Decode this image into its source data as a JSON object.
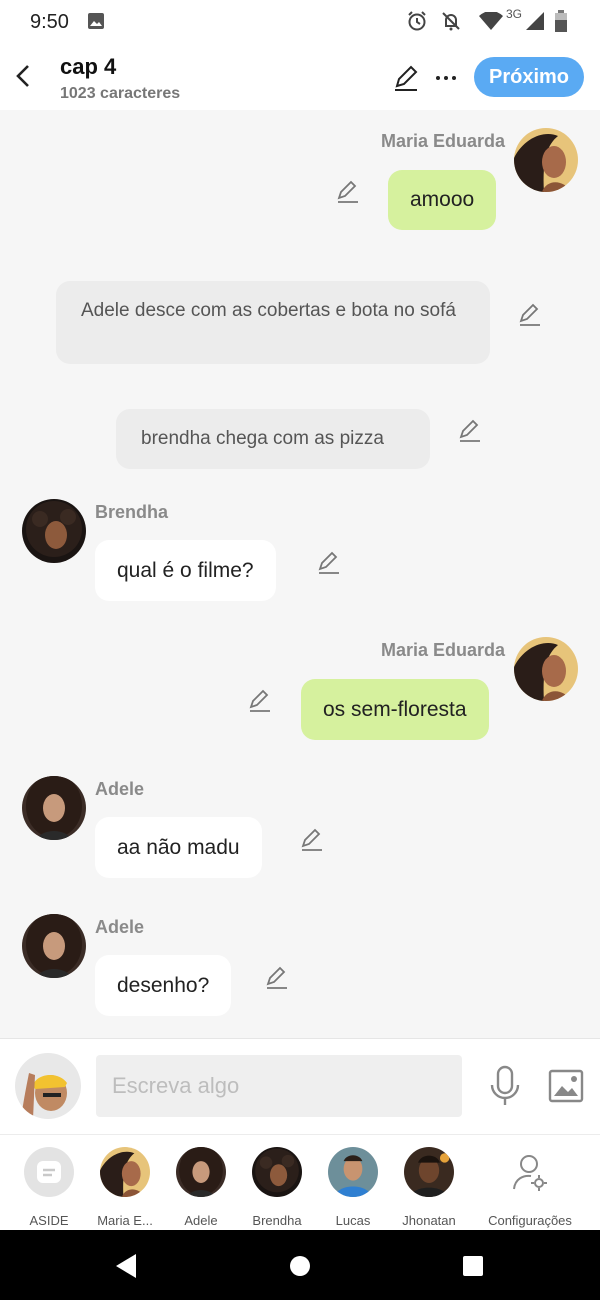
{
  "status_bar": {
    "time": "9:50",
    "network": "3G",
    "icons": [
      "image-icon",
      "alarm-icon",
      "notifications-off-icon",
      "wifi-icon",
      "cell-signal-icon",
      "battery-icon"
    ]
  },
  "header": {
    "title": "cap 4",
    "subtitle": "1023 caracteres",
    "next_label": "Próximo",
    "accent_color": "#5aaaf3"
  },
  "messages": [
    {
      "type": "message",
      "side": "right",
      "sender": "Maria Eduarda",
      "text": "amooo"
    },
    {
      "type": "narration",
      "text": "Adele desce com as cobertas e bota no sofá"
    },
    {
      "type": "narration",
      "text": "brendha chega com as pizza"
    },
    {
      "type": "message",
      "side": "left",
      "sender": "Brendha",
      "text": "qual é o filme?"
    },
    {
      "type": "message",
      "side": "right",
      "sender": "Maria Eduarda",
      "text": "os sem-floresta"
    },
    {
      "type": "message",
      "side": "left",
      "sender": "Adele",
      "text": "aa não madu"
    },
    {
      "type": "message",
      "side": "left",
      "sender": "Adele",
      "text": "desenho?"
    }
  ],
  "composer": {
    "placeholder": "Escreva algo"
  },
  "characters": [
    {
      "label": "ASIDE"
    },
    {
      "label": "Maria E..."
    },
    {
      "label": "Adele"
    },
    {
      "label": "Brendha"
    },
    {
      "label": "Lucas"
    },
    {
      "label": "Jhonatan"
    },
    {
      "label": "Configurações"
    }
  ],
  "colors": {
    "my_bubble": "#d6f19e",
    "their_bubble": "#ffffff",
    "narration_bubble": "#ececec",
    "background": "#f6f6f6"
  }
}
